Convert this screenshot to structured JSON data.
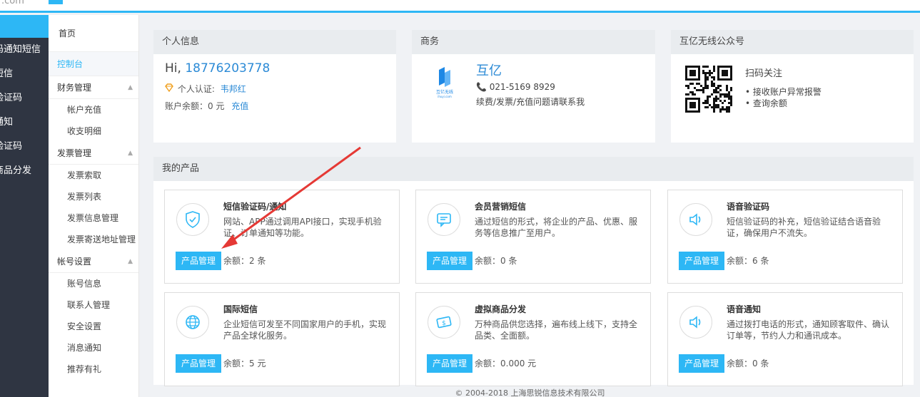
{
  "topbar": {
    "logo_text": ".com"
  },
  "darknav": {
    "items": [
      "码通知短信",
      "短信",
      "验证码",
      "通知",
      "验证码",
      "商品分发"
    ]
  },
  "subnav": {
    "home": "首页",
    "console": "控制台",
    "groups": [
      {
        "label": "财务管理",
        "items": [
          "帐户充值",
          "收支明细"
        ]
      },
      {
        "label": "发票管理",
        "items": [
          "发票索取",
          "发票列表",
          "发票信息管理",
          "发票寄送地址管理"
        ]
      },
      {
        "label": "帐号设置",
        "items": [
          "账号信息",
          "联系人管理",
          "安全设置",
          "消息通知",
          "推荐有礼"
        ]
      }
    ]
  },
  "personal": {
    "title": "个人信息",
    "greeting": "Hi,",
    "phone": "18776203778",
    "cert_label": "个人认证:",
    "cert_name": "韦邦红",
    "balance_label": "账户余额：0 元",
    "recharge": "充值"
  },
  "business": {
    "title": "商务",
    "name": "互亿",
    "phone": "021-5169 8929",
    "note": "续费/发票/充值问题请联系我",
    "logo_text": "互亿无线",
    "logo_sub": "ihuyi.com"
  },
  "wechat": {
    "title": "互亿无线公众号",
    "scan": "扫码关注",
    "items": [
      "• 接收账户异常报警",
      "• 查询余额"
    ]
  },
  "products": {
    "title": "我的产品",
    "button": "产品管理",
    "cards": [
      {
        "title": "短信验证码/通知",
        "desc": "网站、APP通过调用API接口，实现手机验证、订单通知等功能。",
        "balance": "余额：2 条",
        "icon": "shield-check-icon"
      },
      {
        "title": "会员营销短信",
        "desc": "通过短信的形式，将企业的产品、优惠、服务等信息推广至用户。",
        "balance": "余额：0 条",
        "icon": "message-icon"
      },
      {
        "title": "语音验证码",
        "desc": "短信验证码的补充，短信验证结合语音验证，确保用户不流失。",
        "balance": "余额：6 条",
        "icon": "speaker-icon"
      },
      {
        "title": "国际短信",
        "desc": "企业短信可发至不同国家用户的手机，实现产品全球化服务。",
        "balance": "余额：5 元",
        "icon": "globe-icon"
      },
      {
        "title": "虚拟商品分发",
        "desc": "万种商品供您选择，遍布线上线下，支持全品类、全面额。",
        "balance": "余额：0.000 元",
        "icon": "money-icon"
      },
      {
        "title": "语音通知",
        "desc": "通过拨打电话的形式，通知顾客取件、确认订单等，节约人力和通讯成本。",
        "balance": "余额：0 条",
        "icon": "speaker-icon"
      }
    ]
  },
  "footer": {
    "text": "© 2004-2018 上海思锐信息技术有限公司"
  },
  "colors": {
    "accent": "#2db7f5",
    "link": "#2b8ad6",
    "dark_nav": "#2f3542",
    "arrow": "#e53935"
  }
}
